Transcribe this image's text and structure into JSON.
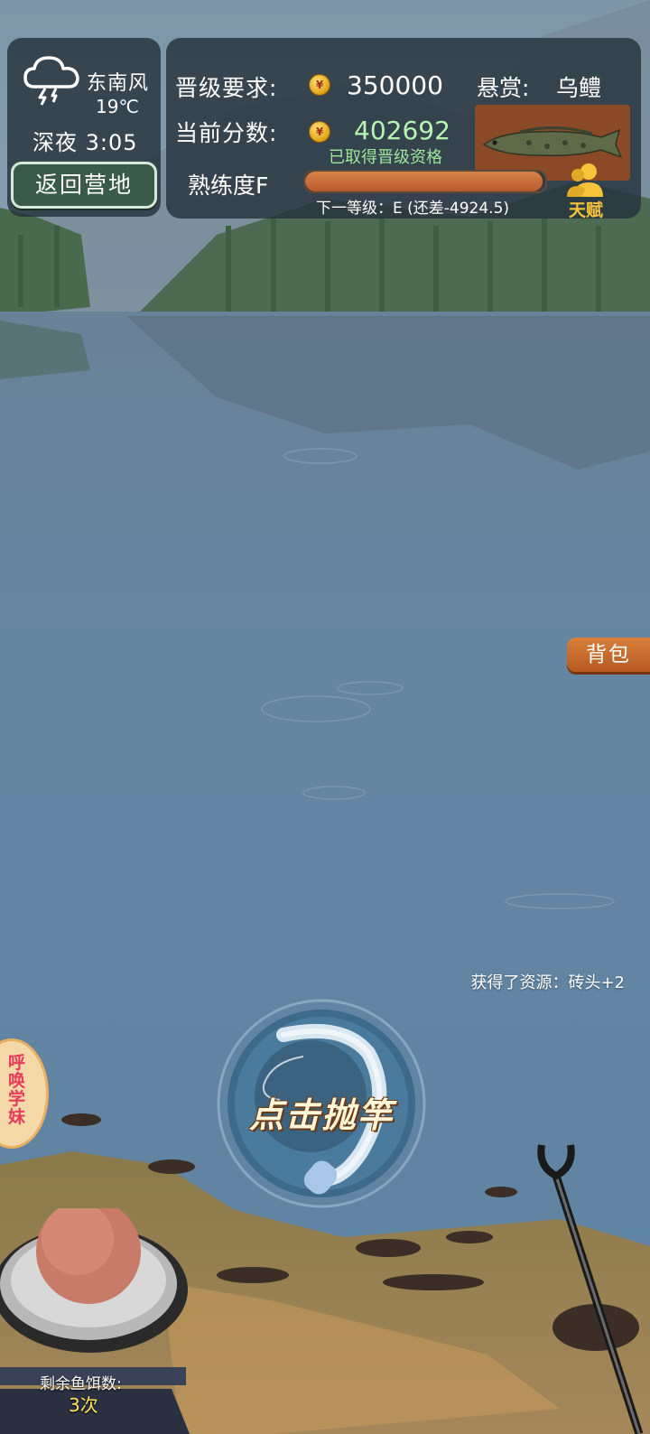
{
  "weather": {
    "icon": "thunderstorm-cloud-icon",
    "wind": "东南风",
    "temperature": "19℃",
    "time": "深夜 3:05",
    "return_label": "返回营地"
  },
  "score_panel": {
    "requirement_label": "晋级要求:",
    "requirement_value": "350000",
    "current_label": "当前分数:",
    "current_value": "402692",
    "qualified_text": "已取得晋级资格",
    "bounty_label": "悬赏:",
    "bounty_fish": "乌鳢",
    "proficiency_label": "熟练度F",
    "proficiency_fraction": 0.99,
    "next_level_text": "下一等级：E (还差-4924.5)",
    "talent_label": "天赋"
  },
  "colors": {
    "accent": "#c8642e",
    "qualified": "#9ee898",
    "panel": "#26323c"
  },
  "backpack_label": "背包",
  "resource_toast": "获得了资源：砖头+2",
  "cast_label": "点击抛竿",
  "summon_label": "呼唤学妹",
  "bait": {
    "label": "剩余鱼饵数:",
    "count": "3次"
  }
}
